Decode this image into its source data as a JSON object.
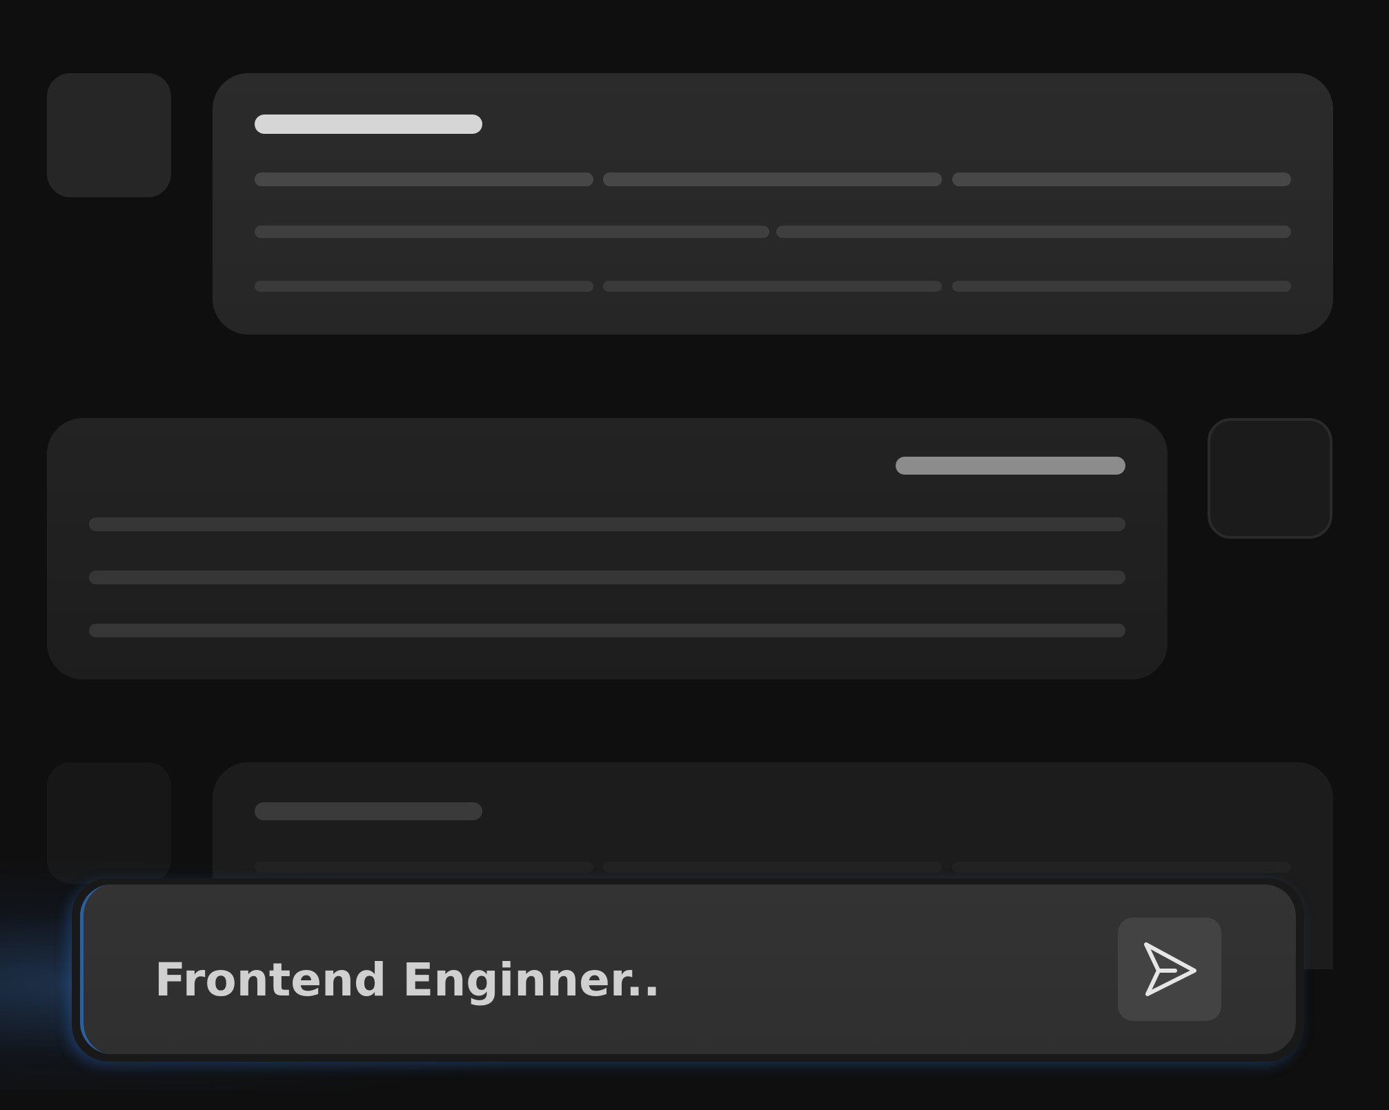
{
  "composer": {
    "input_value": "Frontend Enginner..",
    "send_icon": "send-icon"
  },
  "colors": {
    "background": "#0f0f0f",
    "bubble": "#2b2b2b",
    "input": "#333333",
    "accent_glow": "#2c5f9e"
  }
}
